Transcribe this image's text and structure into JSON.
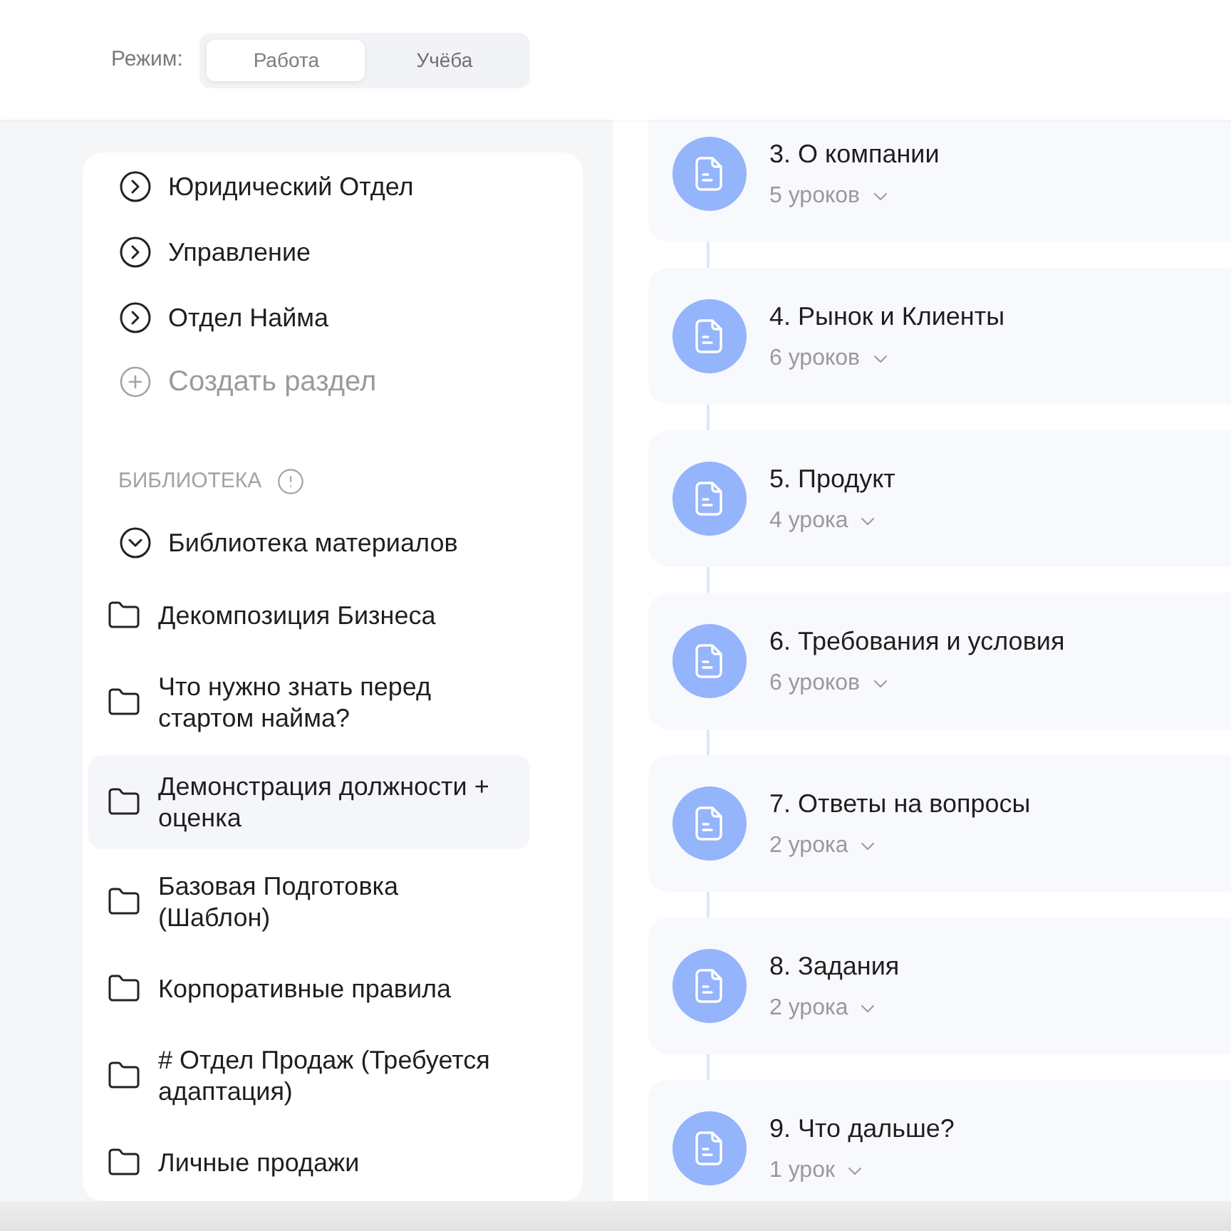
{
  "mode_switch": {
    "label": "Режим:",
    "options": [
      {
        "label": "Работа",
        "selected": true
      },
      {
        "label": "Учёба",
        "selected": false
      }
    ]
  },
  "sidebar": {
    "sections": [
      {
        "label": "Юридический Отдел",
        "expanded": false
      },
      {
        "label": "Управление",
        "expanded": false
      },
      {
        "label": "Отдел Найма",
        "expanded": false
      }
    ],
    "create_section": {
      "label": "Создать раздел"
    },
    "library": {
      "heading": "БИБЛИОТЕКА",
      "groups": [
        {
          "label": "Библиотека материалов",
          "expanded": true,
          "children": [
            {
              "label": "Декомпозиция Бизнеса",
              "selected": false
            },
            {
              "label": "Что нужно знать перед стартом найма?",
              "selected": false
            },
            {
              "label": "Демонстрация должности + оценка",
              "selected": true
            },
            {
              "label": "Базовая Подготовка (Шаблон)",
              "selected": false
            },
            {
              "label": "Корпоративные правила",
              "selected": false
            },
            {
              "label": "# Отдел Продаж (Требуется адаптация)",
              "selected": false
            },
            {
              "label": "Личные продажи",
              "selected": false
            }
          ]
        }
      ]
    }
  },
  "modules": [
    {
      "title": "3. О компании",
      "lessons": "5 уроков",
      "expanded": false
    },
    {
      "title": "4. Рынок и Клиенты",
      "lessons": "6 уроков",
      "expanded": false
    },
    {
      "title": "5. Продукт",
      "lessons": "4 урока",
      "expanded": false
    },
    {
      "title": "6. Требования и условия",
      "lessons": "6 уроков",
      "expanded": false
    },
    {
      "title": "7. Ответы на вопросы",
      "lessons": "2 урока",
      "expanded": false
    },
    {
      "title": "8. Задания",
      "lessons": "2 урока",
      "expanded": false
    },
    {
      "title": "9. Что дальше?",
      "lessons": "1 урок",
      "expanded": false
    }
  ]
}
